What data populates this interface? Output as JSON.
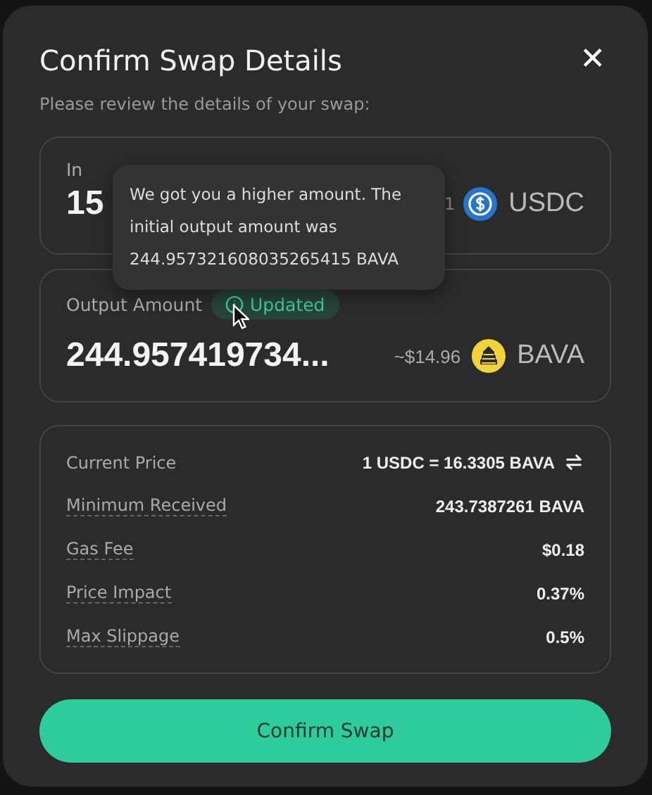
{
  "dialog": {
    "title": "Confirm Swap Details",
    "subtitle": "Please review the details of your swap:",
    "close": "✕"
  },
  "input": {
    "label": "In",
    "amount": "15",
    "usd_value": "1",
    "token": "USDC"
  },
  "tooltip": {
    "text": "We got you a higher amount. The initial output amount was 244.957321608035265415 BAVA"
  },
  "output": {
    "label": "Output Amount",
    "badge": "Updated",
    "amount": "244.957419734...",
    "usd_value": "~$14.96",
    "token": "BAVA"
  },
  "details": [
    {
      "label": "Current Price",
      "value": "1 USDC = 16.3305 BAVA",
      "underlined": false,
      "swap_icon": true
    },
    {
      "label": "Minimum Received",
      "value": "243.7387261 BAVA",
      "underlined": true,
      "swap_icon": false
    },
    {
      "label": "Gas Fee",
      "value": "$0.18",
      "underlined": true,
      "swap_icon": false
    },
    {
      "label": "Price Impact",
      "value": "0.37%",
      "underlined": true,
      "swap_icon": false
    },
    {
      "label": "Max Slippage",
      "value": "0.5%",
      "underlined": true,
      "swap_icon": false
    }
  ],
  "confirm_button": "Confirm Swap"
}
